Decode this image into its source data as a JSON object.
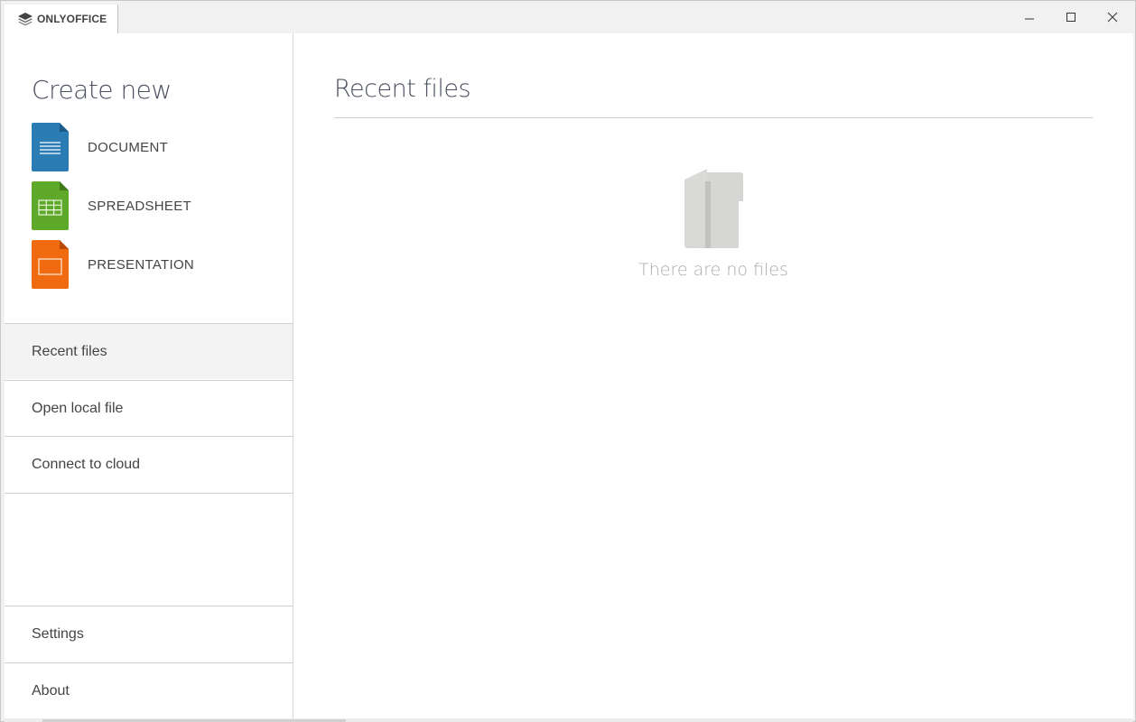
{
  "window": {
    "app_name": "ONLYOFFICE",
    "controls": {
      "minimize": "minimize-icon",
      "maximize": "maximize-icon",
      "close": "close-icon"
    }
  },
  "sidebar": {
    "create_title": "Create new",
    "create_items": [
      {
        "label": "DOCUMENT",
        "icon": "document-icon",
        "color": "#2b7bb5"
      },
      {
        "label": "SPREADSHEET",
        "icon": "spreadsheet-icon",
        "color": "#5ea82a"
      },
      {
        "label": "PRESENTATION",
        "icon": "presentation-icon",
        "color": "#f06a10"
      }
    ],
    "nav_items": [
      {
        "label": "Recent files",
        "active": true
      },
      {
        "label": "Open local file",
        "active": false
      },
      {
        "label": "Connect to cloud",
        "active": false
      }
    ],
    "bottom_items": [
      {
        "label": "Settings"
      },
      {
        "label": "About"
      }
    ]
  },
  "main": {
    "title": "Recent files",
    "empty_icon": "empty-folder-icon",
    "empty_text": "There are no files"
  }
}
